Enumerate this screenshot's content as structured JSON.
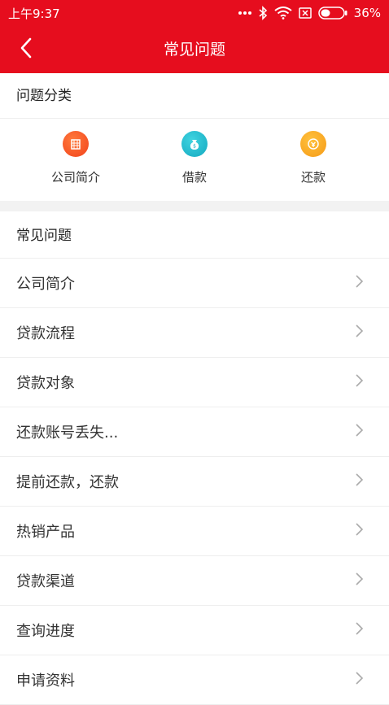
{
  "status_bar": {
    "time": "上午9:37",
    "battery": "36%"
  },
  "nav": {
    "title": "常见问题",
    "back_icon": "chevron-left-icon"
  },
  "categories_section": {
    "title": "问题分类",
    "items": [
      {
        "label": "公司简介",
        "icon": "building-icon",
        "color": "#f4511e"
      },
      {
        "label": "借款",
        "icon": "money-bag-icon",
        "color": "#1bb6c9"
      },
      {
        "label": "还款",
        "icon": "repay-coin-icon",
        "color": "#f7a21b"
      }
    ]
  },
  "faq_section": {
    "title": "常见问题",
    "items": [
      {
        "label": "公司简介"
      },
      {
        "label": "贷款流程"
      },
      {
        "label": "贷款对象"
      },
      {
        "label": "还款账号丢失..."
      },
      {
        "label": "提前还款，还款"
      },
      {
        "label": "热销产品"
      },
      {
        "label": "贷款渠道"
      },
      {
        "label": "查询进度"
      },
      {
        "label": "申请资料"
      }
    ]
  },
  "colors": {
    "brand_red": "#e60d1e",
    "chevron": "#aaaaaa"
  }
}
